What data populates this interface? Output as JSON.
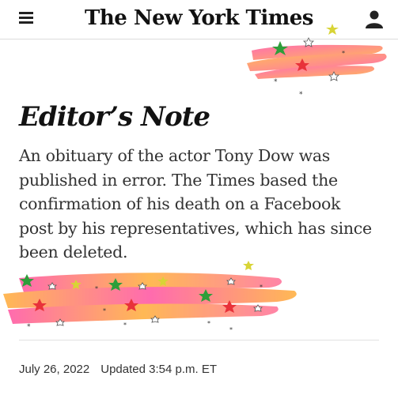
{
  "header": {
    "logo_text": "The New York Times",
    "menu_icon": "hamburger-menu-icon",
    "account_icon": "user-account-icon"
  },
  "article": {
    "title": "Editor’s Note",
    "body": "An obituary of the actor Tony Dow was published in error. The Times based the confirmation of his death on a Facebook post by his representatives, which has since been deleted.",
    "date": "July 26, 2022",
    "updated": "Updated 3:54 p.m. ET"
  },
  "decoration": {
    "highlight_gradient": [
      "#ff5fa8",
      "#ffb347"
    ],
    "star_colors": [
      "#2e9e3a",
      "#e8323a",
      "#d8d436"
    ]
  }
}
